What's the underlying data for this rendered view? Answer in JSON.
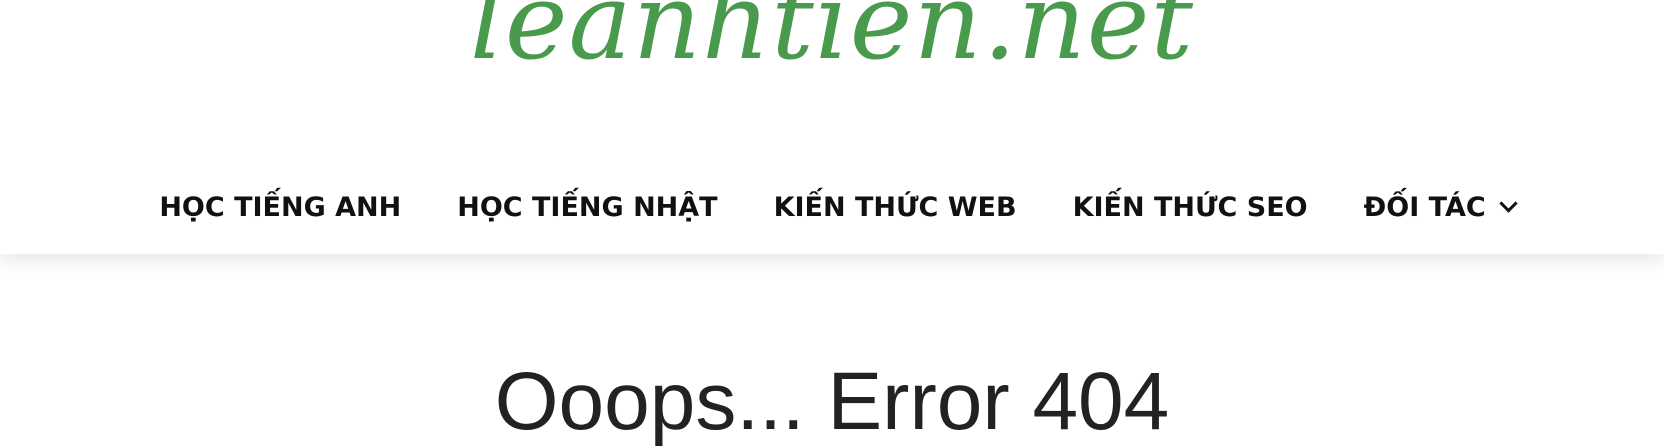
{
  "header": {
    "logo_text": "leanhtien.net",
    "logo_color": "#4a9a4e"
  },
  "nav": {
    "items": [
      {
        "label": "HỌC TIẾNG ANH"
      },
      {
        "label": "HỌC TIẾNG NHẬT"
      },
      {
        "label": "KIẾN THỨC WEB"
      },
      {
        "label": "KIẾN THỨC SEO"
      },
      {
        "label": "ĐỐI TÁC",
        "icon": "chevron-down-icon"
      }
    ]
  },
  "main": {
    "title": "Ooops... Error 404"
  }
}
